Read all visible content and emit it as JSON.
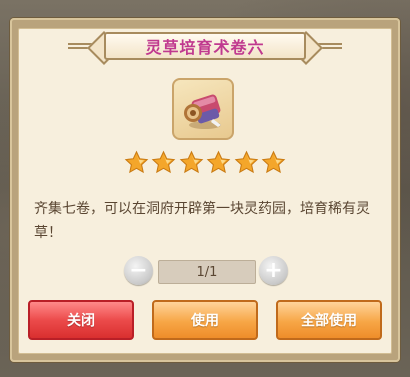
{
  "dialog": {
    "title": "灵草培育术卷六",
    "item_icon": "scroll-item-icon",
    "stars": 6,
    "star_color": "#f4a62a",
    "description": "齐集七卷，可以在洞府开辟第一块灵药园，培育稀有灵草！"
  },
  "stepper": {
    "minus_icon": "minus-icon",
    "plus_icon": "plus-icon",
    "count": "1/1"
  },
  "buttons": {
    "close": "关闭",
    "use": "使用",
    "use_all": "全部使用"
  },
  "colors": {
    "title": "#c0398f",
    "close_button": "#ec4b4b",
    "action_button": "#f7a646"
  }
}
